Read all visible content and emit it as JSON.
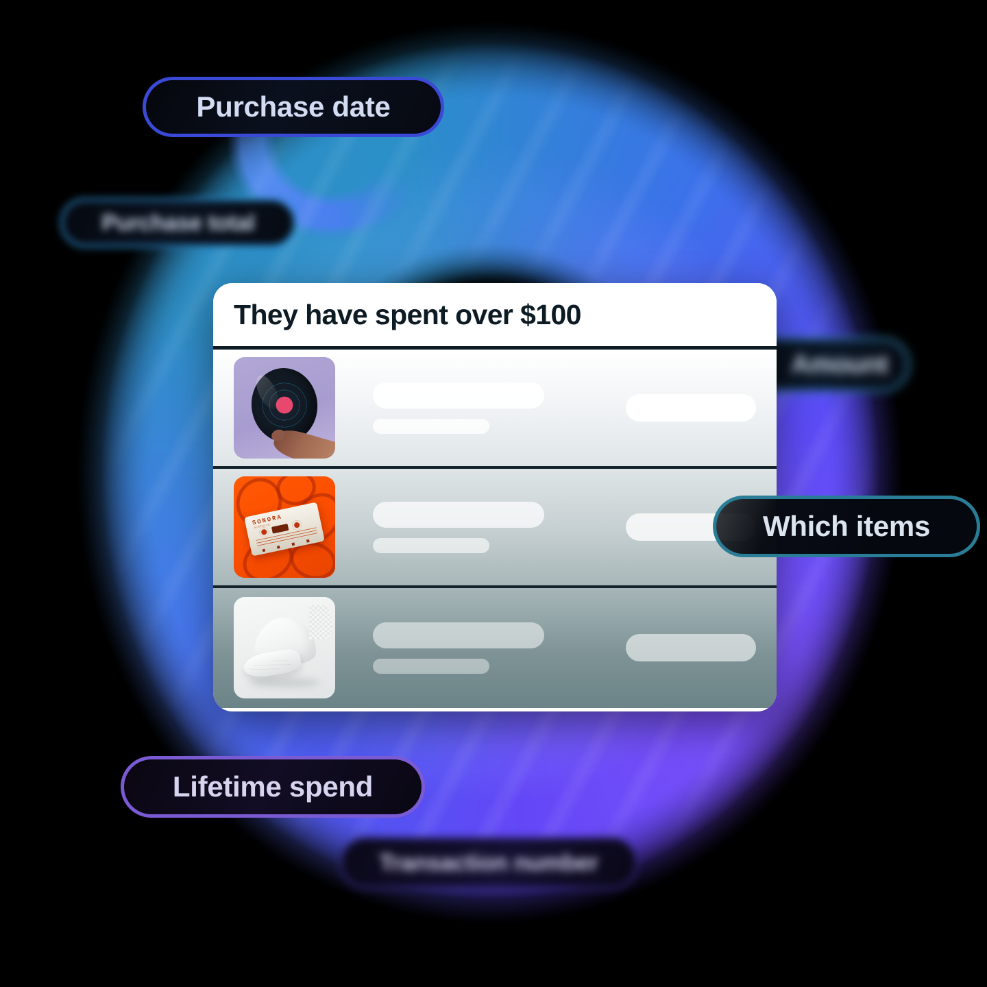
{
  "card": {
    "title": "They have spent over $100",
    "rows": [
      {
        "thumbnail": "vinyl-record-image",
        "primary_placeholder": "",
        "secondary_placeholder": "",
        "amount_placeholder": ""
      },
      {
        "thumbnail": "cassette-tape-image",
        "brand": "SONORA",
        "brand_sub": "ACAPULCO",
        "primary_placeholder": "",
        "secondary_placeholder": "",
        "amount_placeholder": ""
      },
      {
        "thumbnail": "white-cap-image",
        "primary_placeholder": "",
        "secondary_placeholder": "",
        "amount_placeholder": ""
      }
    ]
  },
  "pills": {
    "purchase_date": "Purchase date",
    "purchase_total": "Purchase total",
    "amount": "Amount",
    "which_items": "Which items",
    "lifetime_spend": "Lifetime spend",
    "transaction_number": "Transaction number"
  },
  "colors": {
    "background": "#000000",
    "ring_blue": "#4a7df0",
    "ring_cyan": "#2e8ec4",
    "ring_violet": "#6a4df5",
    "pill_border_blue": "#3a4ad6",
    "pill_border_teal": "#2a7d96",
    "pill_border_purple": "#7a5bd4",
    "card_title": "#0d1b24",
    "card_surface": "#ffffff"
  }
}
